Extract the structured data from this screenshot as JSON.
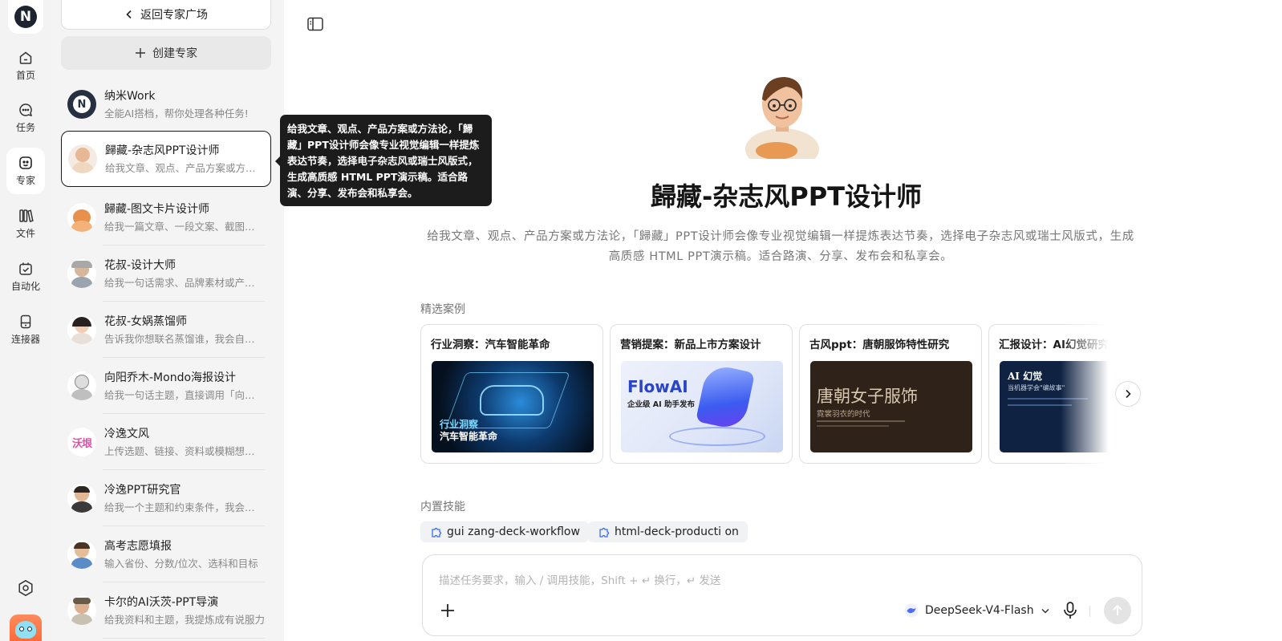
{
  "rail": {
    "logo_letter": "N",
    "items": [
      {
        "label": "首页",
        "icon": "home-icon"
      },
      {
        "label": "任务",
        "icon": "chat-bubble-icon"
      },
      {
        "label": "专家",
        "icon": "expert-face-icon",
        "active": true
      },
      {
        "label": "文件",
        "icon": "books-icon"
      },
      {
        "label": "自动化",
        "icon": "calendar-check-icon"
      },
      {
        "label": "连接器",
        "icon": "device-icon"
      }
    ]
  },
  "panel": {
    "back_label": "返回专家广场",
    "create_label": "创建专家",
    "experts": [
      {
        "name": "纳米Work",
        "desc": "全能AI搭档，帮你处理各种任务!"
      },
      {
        "name": "歸藏-杂志风PPT设计师",
        "desc": "给我文章、观点、产品方案或方法论，「歸藏」PPT设计师会像专业视觉编辑一样提炼表达节奏",
        "selected": true
      },
      {
        "name": "歸藏-图文卡片设计师",
        "desc": "给我一篇文章、一段文案、截图或想法"
      },
      {
        "name": "花叔-设计大师",
        "desc": "给我一句话需求、品牌素材或产品截图"
      },
      {
        "name": "花叔-女娲蒸馏师",
        "desc": "告诉我你想联名蒸馏谁，我会自动调研"
      },
      {
        "name": "向阳乔木-Mondo海报设计",
        "desc": "给我一句话主题，直接调用「向日葵」"
      },
      {
        "name": "冷逸文风",
        "desc": "上传选题、链接、资料或模糊想法给我"
      },
      {
        "name": "冷逸PPT研究官",
        "desc": "给我一个主题和约束条件，我会用研究"
      },
      {
        "name": "高考志愿填报",
        "desc": "输入省份、分数/位次、选科和目标"
      },
      {
        "name": "卡尔的AI沃茨-PPT导演",
        "desc": "给我资料和主题，我提炼成有说服力"
      }
    ],
    "logo_text_cold": "沃垠"
  },
  "tooltip": "给我文章、观点、产品方案或方法论，「歸藏」PPT设计师会像专业视觉编辑一样提炼表达节奏，选择电子杂志风或瑞士风版式，生成高质感 HTML PPT演示稿。适合路演、分享、发布会和私享会。",
  "main": {
    "title": "歸藏-杂志风PPT设计师",
    "desc": "给我文章、观点、产品方案或方法论，「歸藏」PPT设计师会像专业视觉编辑一样提炼表达节奏，选择电子杂志风或瑞士风版式，生成高质感 HTML PPT演示稿。适合路演、分享、发布会和私享会。",
    "cases_label": "精选案例",
    "cases": [
      {
        "title": "行业洞察：汽车智能革命",
        "img_line1": "行业洞察",
        "img_line2": "汽车智能革命"
      },
      {
        "title": "营销提案：新品上市方案设计",
        "img_brand": "FlowAI",
        "img_sub": "企业级 AI 助手发布"
      },
      {
        "title": "古风ppt：唐朝服饰特性研究",
        "img_heading": "唐朝女子服饰",
        "img_sub": "霓裳羽衣的时代"
      },
      {
        "title": "汇报设计：AI幻觉研究",
        "img_heading": "AI 幻觉",
        "img_sub": "当机器学会\"编故事\""
      }
    ],
    "skills_label": "内置技能",
    "skills": [
      "gui zang-deck-workflow",
      "html-deck-producti on"
    ]
  },
  "composer": {
    "placeholder": "描述任务要求，输入 / 调用技能，Shift + ↵ 换行，↵ 发送",
    "model": "DeepSeek-V4-Flash"
  }
}
